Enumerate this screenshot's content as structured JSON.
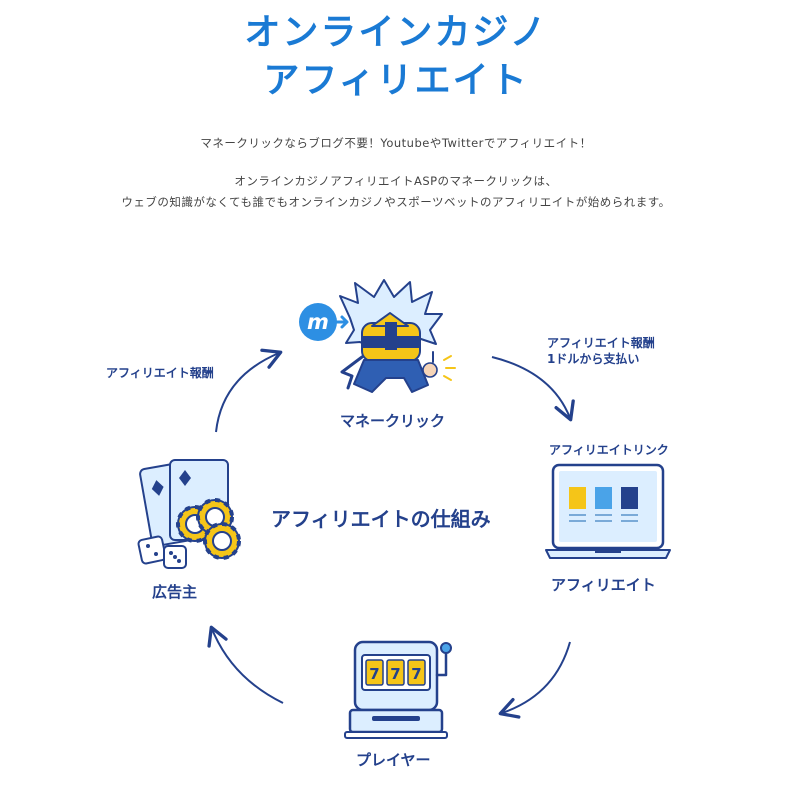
{
  "header": {
    "title_line1": "オンラインカジノ",
    "title_line2": "アフィリエイト",
    "intro_line1": "マネークリックならブログ不要！YoutubeやTwitterでアフィリエイト！",
    "intro_line2": "オンラインカジノアフィリエイトASPのマネークリックは、",
    "intro_line3": "ウェブの知識がなくても誰でもオンラインカジノやスポーツベットのアフィリエイトが始められます。"
  },
  "diagram": {
    "center_title": "アフィリエイトの仕組み",
    "nodes": {
      "moneyclick": "マネークリック",
      "affiliate": "アフィリエイト",
      "player": "プレイヤー",
      "advertiser": "広告主"
    },
    "edge_labels": {
      "reward_to_moneyclick": "アフィリエイト報酬",
      "reward_line1": "アフィリエイト報酬",
      "reward_line2": "1ドルから支払い",
      "affiliate_link": "アフィリエイトリンク"
    },
    "slot_digits": [
      "7",
      "7",
      "7"
    ],
    "logo_letter": "m"
  },
  "colors": {
    "title_blue": "#1a7ad4",
    "navy": "#24418c",
    "light_blue": "#dceeff",
    "mid_blue": "#4aa3e8",
    "yellow": "#f5c518"
  }
}
